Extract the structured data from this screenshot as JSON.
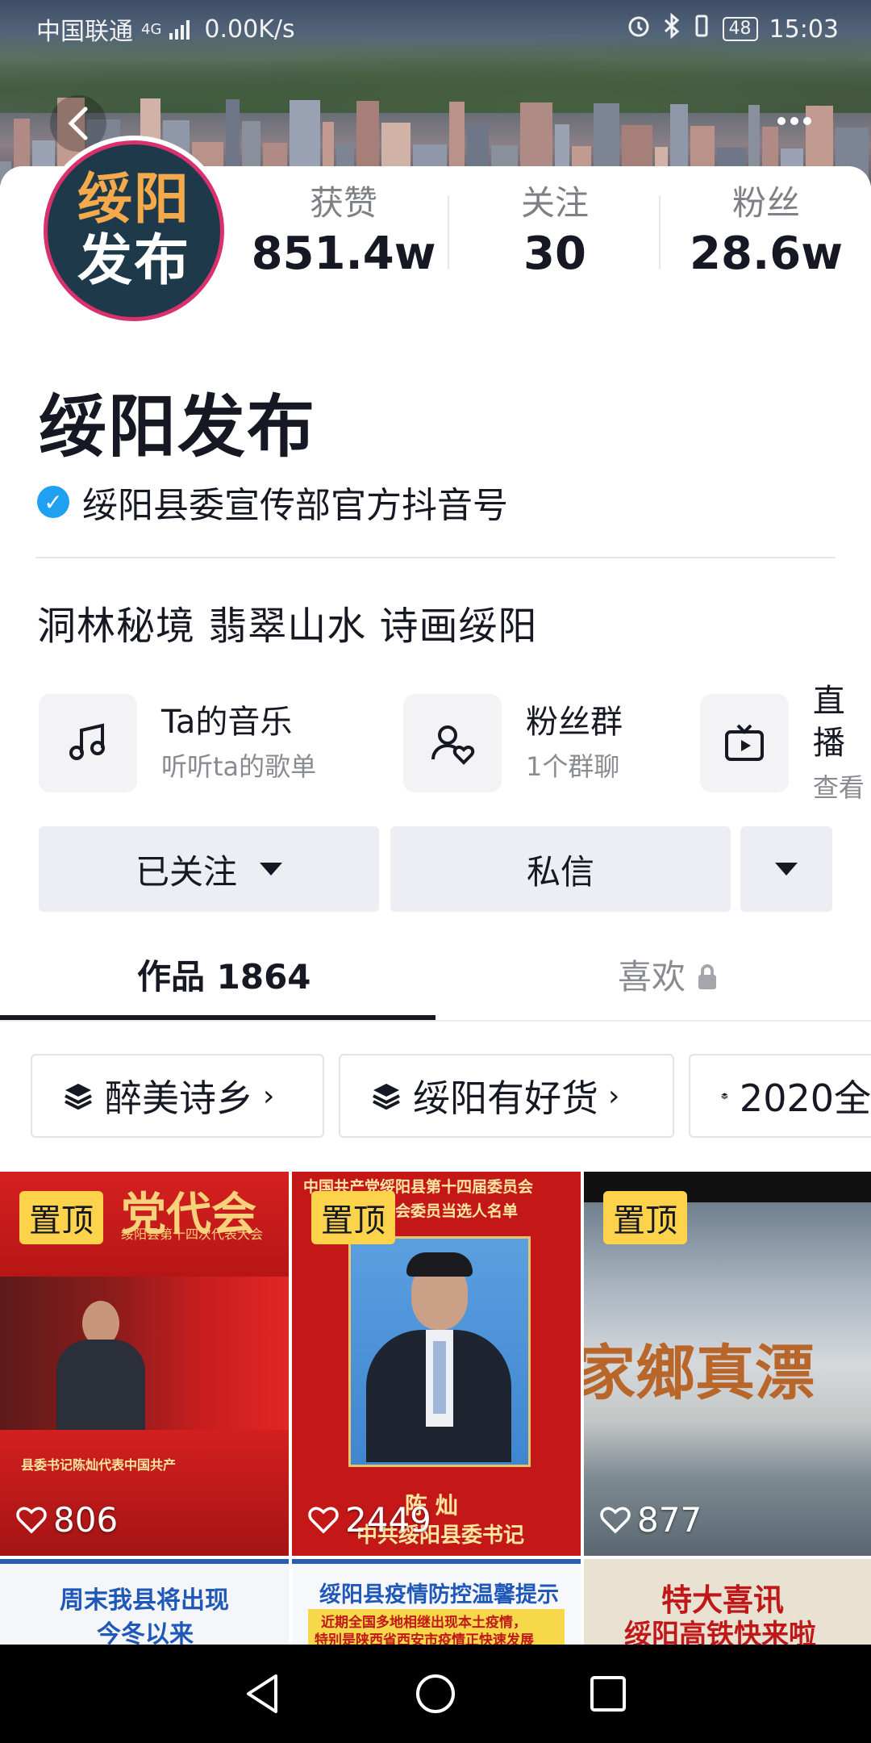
{
  "status_bar": {
    "carrier": "中国联通",
    "network": "4G",
    "speed": "0.00K/s",
    "battery": "48",
    "time": "15:03"
  },
  "profile": {
    "avatar_line1": "绥阳",
    "avatar_line2": "发布",
    "name": "绥阳发布",
    "verification": "绥阳县委宣传部官方抖音号",
    "bio": "洞林秘境 翡翠山水 诗画绥阳"
  },
  "stats": [
    {
      "label": "获赞",
      "value": "851.4w"
    },
    {
      "label": "关注",
      "value": "30"
    },
    {
      "label": "粉丝",
      "value": "28.6w"
    }
  ],
  "features": [
    {
      "title": "Ta的音乐",
      "subtitle": "听听ta的歌单",
      "icon": "music-note-icon"
    },
    {
      "title": "粉丝群",
      "subtitle": "1个群聊",
      "icon": "fans-group-icon"
    },
    {
      "title": "直播",
      "subtitle": "查看",
      "icon": "live-tv-icon"
    }
  ],
  "actions": {
    "follow_label": "已关注",
    "message_label": "私信"
  },
  "tabs": {
    "works_label": "作品 1864",
    "likes_label": "喜欢"
  },
  "collections": [
    {
      "label": "醉美诗乡"
    },
    {
      "label": "绥阳有好货"
    },
    {
      "label": "2020全"
    }
  ],
  "videos": [
    {
      "pinned_label": "置顶",
      "likes": "806",
      "headline": "县委书记陈灿代表中国共产",
      "banner": "党代会",
      "subbanner": "绥阳县第十四次代表大会"
    },
    {
      "pinned_label": "置顶",
      "likes": "2449",
      "headline": "中国共产党绥阳县第十四届委员会",
      "subbanner": "委员会委员当选人名单",
      "caption_name": "陈 灿",
      "caption_title": "中共绥阳县委书记"
    },
    {
      "pinned_label": "置顶",
      "likes": "877",
      "banner": "家鄉真漂"
    }
  ],
  "videos_row2": [
    {
      "text1": "周末我县将出现",
      "text2": "今冬以来"
    },
    {
      "text1": "绥阳县疫情防控温馨提示",
      "text2": "近期全国多地相继出现本土疫情，",
      "text3": "特别是陕西省西安市疫情正快速发展"
    },
    {
      "text1": "特大喜讯",
      "text2": "绥阳高铁快来啦"
    }
  ],
  "colors": {
    "accent_blue": "#20a0f0",
    "pin_yellow": "#fcd34a",
    "text_primary": "#161823",
    "text_secondary": "#8a8b91"
  }
}
